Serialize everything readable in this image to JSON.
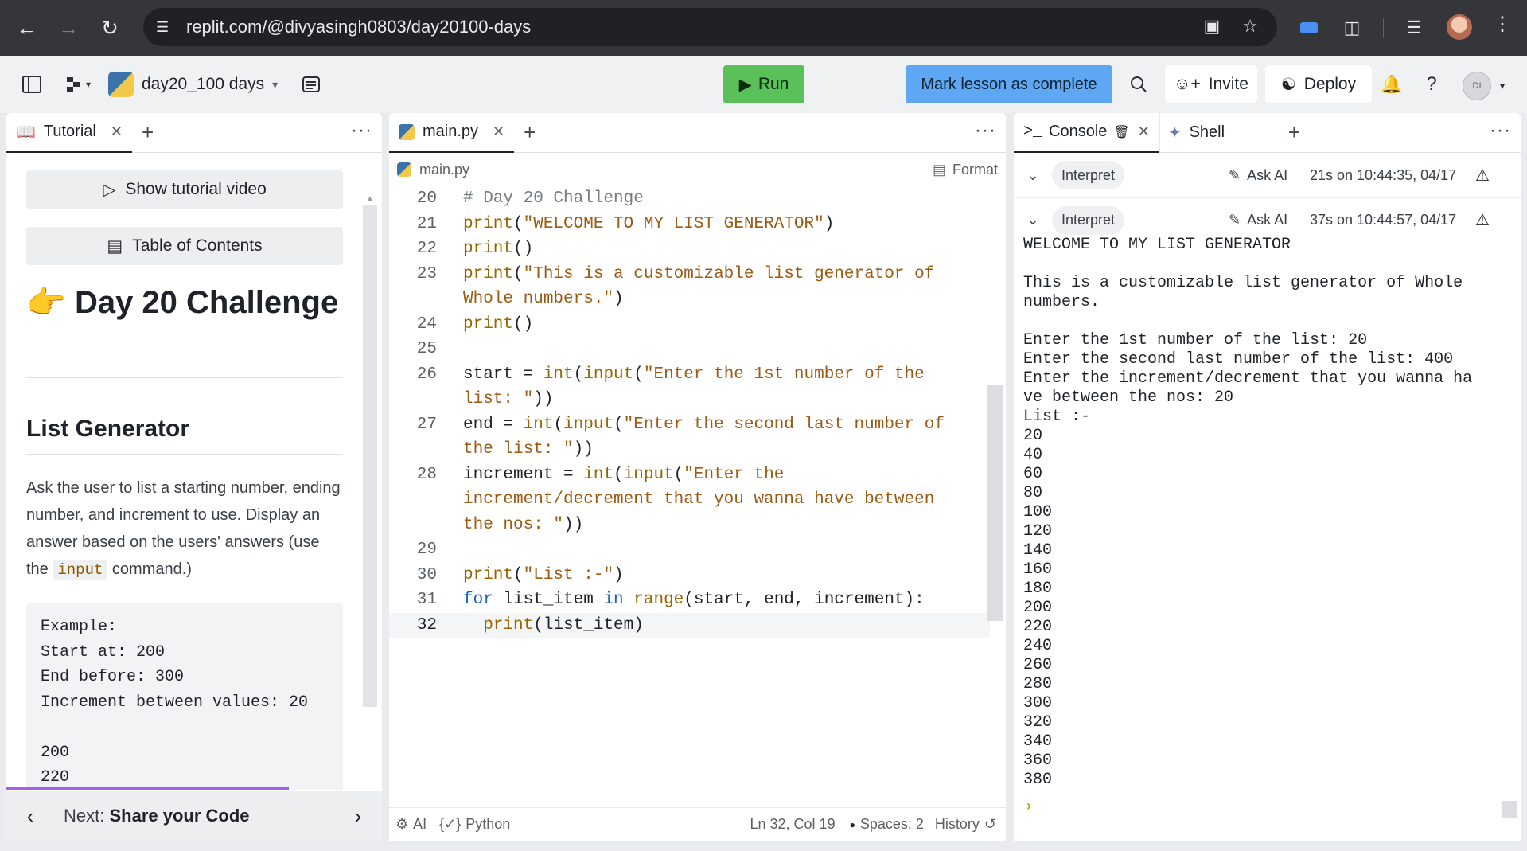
{
  "browser": {
    "url": "replit.com/@divyasingh0803/day20100-days"
  },
  "topbar": {
    "repl_name": "day20_100 days",
    "run_label": "Run",
    "mark_complete_label": "Mark lesson as complete",
    "invite_label": "Invite",
    "deploy_label": "Deploy",
    "avatar_initials": "DI",
    "colors": {
      "run": "#5ac05a",
      "mark": "#5ea7f2"
    }
  },
  "tutorial": {
    "tab_label": "Tutorial",
    "show_video_label": "Show tutorial video",
    "toc_label": "Table of Contents",
    "heading_emoji": "👉",
    "heading": "Day 20 Challenge",
    "subheading": "List Generator",
    "paragraph_pre": "Ask the user to list a starting number, ending number, and increment to use. Display an answer based on the users' answers (use the ",
    "paragraph_code": "input",
    "paragraph_post": " command.)",
    "example": "Example:\nStart at: 200\nEnd before: 300\nIncrement between values: 20\n\n200\n220",
    "next_prefix": "Next: ",
    "next_title": "Share your Code"
  },
  "editor": {
    "tab_label": "main.py",
    "breadcrumb": "main.py",
    "format_label": "Format",
    "footer": {
      "ai": "AI",
      "language": "Python",
      "position": "Ln 32, Col 19",
      "spaces": "Spaces: 2",
      "history": "History"
    }
  },
  "console": {
    "tab_label": "Console",
    "shell_tab_label": "Shell",
    "runs": [
      {
        "interpret": "Interpret",
        "ask_ai": "Ask AI",
        "time": "21s on 10:44:35, 04/17"
      },
      {
        "interpret": "Interpret",
        "ask_ai": "Ask AI",
        "time": "37s on 10:44:57, 04/17"
      }
    ],
    "output": [
      "WELCOME TO MY LIST GENERATOR",
      "",
      "This is a customizable list generator of Whole",
      "numbers.",
      "",
      "Enter the 1st number of the list: 20",
      "Enter the second last number of the list: 400",
      "Enter the increment/decrement that you wanna ha",
      "ve between the nos: 20",
      "List :-",
      "20",
      "40",
      "60",
      "80",
      "100",
      "120",
      "140",
      "160",
      "180",
      "200",
      "220",
      "240",
      "260",
      "280",
      "300",
      "320",
      "340",
      "360",
      "380"
    ]
  }
}
